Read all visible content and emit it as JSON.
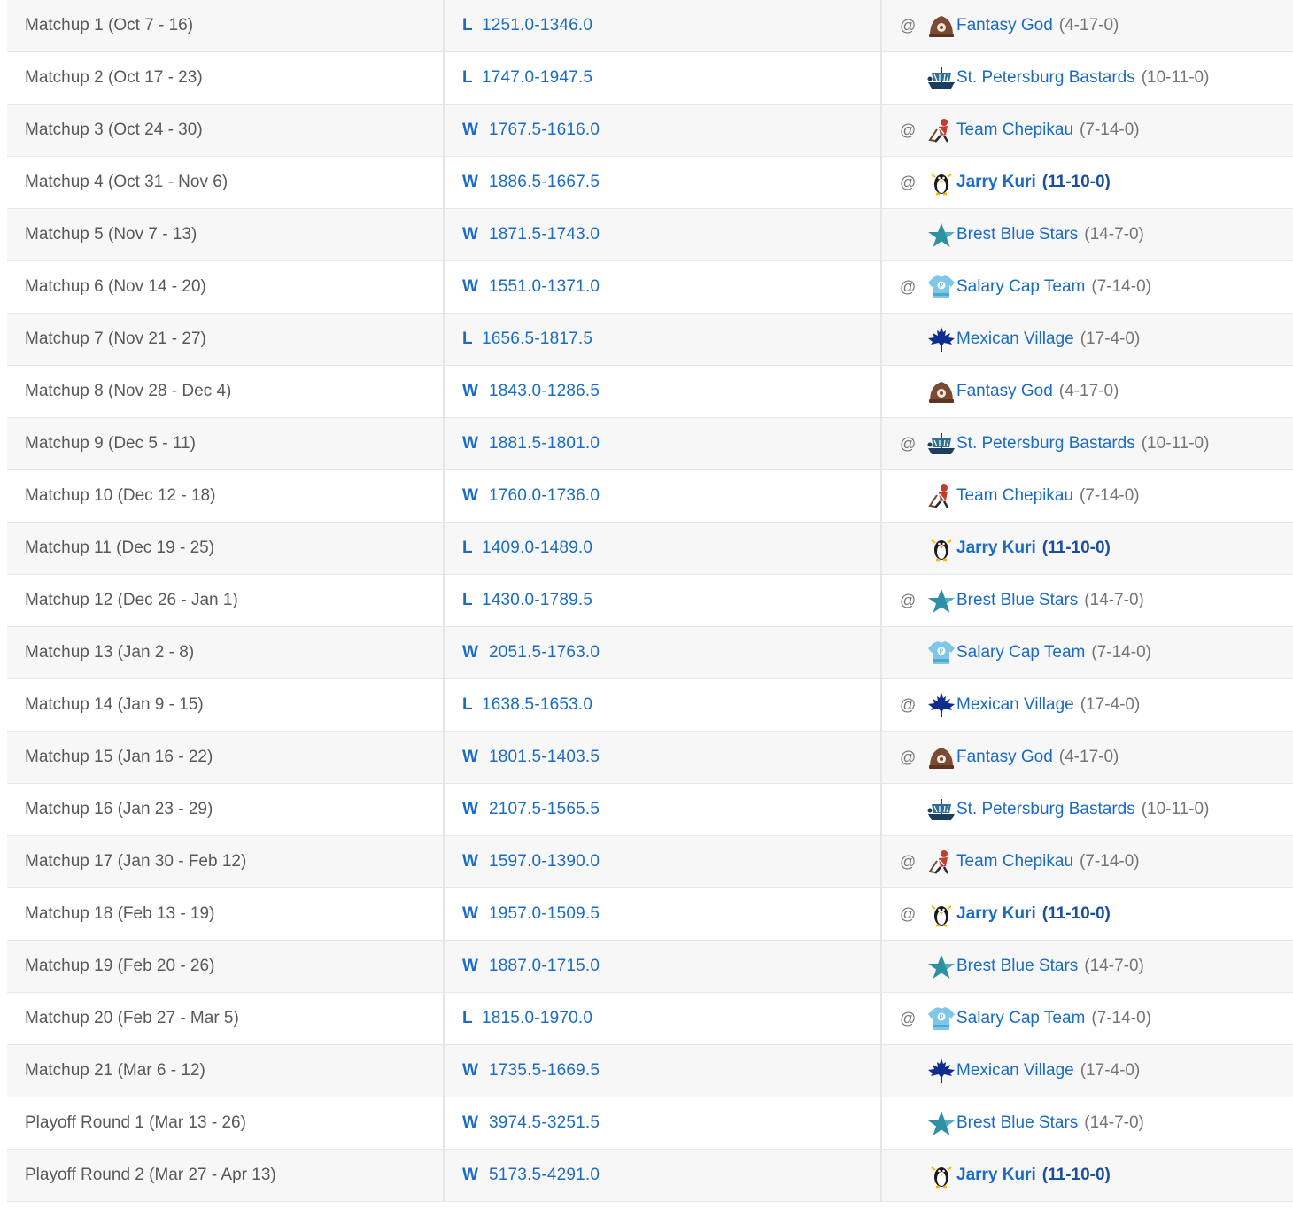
{
  "colors": {
    "link": "#1a6bc6",
    "week_text": "#595959",
    "record_text": "#757575",
    "row_alt": "#f7f7f7"
  },
  "rows": [
    {
      "week": "Matchup 1 (Oct 7 - 16)",
      "result": "L",
      "score": "1251.0-1346.0",
      "at": "@",
      "team": "Fantasy God",
      "record": "(4-17-0)",
      "logo": "hat-icon",
      "bold": false
    },
    {
      "week": "Matchup 2 (Oct 17 - 23)",
      "result": "L",
      "score": "1747.0-1947.5",
      "at": "",
      "team": "St. Petersburg Bastards",
      "record": "(10-11-0)",
      "logo": "viking-ship-icon",
      "bold": false
    },
    {
      "week": "Matchup 3 (Oct 24 - 30)",
      "result": "W",
      "score": "1767.5-1616.0",
      "at": "@",
      "team": "Team Chepikau",
      "record": "(7-14-0)",
      "logo": "hockey-player-icon",
      "bold": false
    },
    {
      "week": "Matchup 4 (Oct 31 - Nov 6)",
      "result": "W",
      "score": "1886.5-1667.5",
      "at": "@",
      "team": "Jarry Kuri",
      "record": "(11-10-0)",
      "logo": "penguin-icon",
      "bold": true
    },
    {
      "week": "Matchup 5 (Nov 7 - 13)",
      "result": "W",
      "score": "1871.5-1743.0",
      "at": "",
      "team": "Brest Blue Stars",
      "record": "(14-7-0)",
      "logo": "star-icon",
      "bold": false
    },
    {
      "week": "Matchup 6 (Nov 14 - 20)",
      "result": "W",
      "score": "1551.0-1371.0",
      "at": "@",
      "team": "Salary Cap Team",
      "record": "(7-14-0)",
      "logo": "jersey-icon",
      "bold": false
    },
    {
      "week": "Matchup 7 (Nov 21 - 27)",
      "result": "L",
      "score": "1656.5-1817.5",
      "at": "",
      "team": "Mexican Village",
      "record": "(17-4-0)",
      "logo": "maple-leaf-icon",
      "bold": false
    },
    {
      "week": "Matchup 8 (Nov 28 - Dec 4)",
      "result": "W",
      "score": "1843.0-1286.5",
      "at": "",
      "team": "Fantasy God",
      "record": "(4-17-0)",
      "logo": "hat-icon",
      "bold": false
    },
    {
      "week": "Matchup 9 (Dec 5 - 11)",
      "result": "W",
      "score": "1881.5-1801.0",
      "at": "@",
      "team": "St. Petersburg Bastards",
      "record": "(10-11-0)",
      "logo": "viking-ship-icon",
      "bold": false
    },
    {
      "week": "Matchup 10 (Dec 12 - 18)",
      "result": "W",
      "score": "1760.0-1736.0",
      "at": "",
      "team": "Team Chepikau",
      "record": "(7-14-0)",
      "logo": "hockey-player-icon",
      "bold": false
    },
    {
      "week": "Matchup 11 (Dec 19 - 25)",
      "result": "L",
      "score": "1409.0-1489.0",
      "at": "",
      "team": "Jarry Kuri",
      "record": "(11-10-0)",
      "logo": "penguin-icon",
      "bold": true
    },
    {
      "week": "Matchup 12 (Dec 26 - Jan 1)",
      "result": "L",
      "score": "1430.0-1789.5",
      "at": "@",
      "team": "Brest Blue Stars",
      "record": "(14-7-0)",
      "logo": "star-icon",
      "bold": false
    },
    {
      "week": "Matchup 13 (Jan 2 - 8)",
      "result": "W",
      "score": "2051.5-1763.0",
      "at": "",
      "team": "Salary Cap Team",
      "record": "(7-14-0)",
      "logo": "jersey-icon",
      "bold": false
    },
    {
      "week": "Matchup 14 (Jan 9 - 15)",
      "result": "L",
      "score": "1638.5-1653.0",
      "at": "@",
      "team": "Mexican Village",
      "record": "(17-4-0)",
      "logo": "maple-leaf-icon",
      "bold": false
    },
    {
      "week": "Matchup 15 (Jan 16 - 22)",
      "result": "W",
      "score": "1801.5-1403.5",
      "at": "@",
      "team": "Fantasy God",
      "record": "(4-17-0)",
      "logo": "hat-icon",
      "bold": false
    },
    {
      "week": "Matchup 16 (Jan 23 - 29)",
      "result": "W",
      "score": "2107.5-1565.5",
      "at": "",
      "team": "St. Petersburg Bastards",
      "record": "(10-11-0)",
      "logo": "viking-ship-icon",
      "bold": false
    },
    {
      "week": "Matchup 17 (Jan 30 - Feb 12)",
      "result": "W",
      "score": "1597.0-1390.0",
      "at": "@",
      "team": "Team Chepikau",
      "record": "(7-14-0)",
      "logo": "hockey-player-icon",
      "bold": false
    },
    {
      "week": "Matchup 18 (Feb 13 - 19)",
      "result": "W",
      "score": "1957.0-1509.5",
      "at": "@",
      "team": "Jarry Kuri",
      "record": "(11-10-0)",
      "logo": "penguin-icon",
      "bold": true
    },
    {
      "week": "Matchup 19 (Feb 20 - 26)",
      "result": "W",
      "score": "1887.0-1715.0",
      "at": "",
      "team": "Brest Blue Stars",
      "record": "(14-7-0)",
      "logo": "star-icon",
      "bold": false
    },
    {
      "week": "Matchup 20 (Feb 27 - Mar 5)",
      "result": "L",
      "score": "1815.0-1970.0",
      "at": "@",
      "team": "Salary Cap Team",
      "record": "(7-14-0)",
      "logo": "jersey-icon",
      "bold": false
    },
    {
      "week": "Matchup 21 (Mar 6 - 12)",
      "result": "W",
      "score": "1735.5-1669.5",
      "at": "",
      "team": "Mexican Village",
      "record": "(17-4-0)",
      "logo": "maple-leaf-icon",
      "bold": false
    },
    {
      "week": "Playoff Round 1 (Mar 13 - 26)",
      "result": "W",
      "score": "3974.5-3251.5",
      "at": "",
      "team": "Brest Blue Stars",
      "record": "(14-7-0)",
      "logo": "star-icon",
      "bold": false
    },
    {
      "week": "Playoff Round 2 (Mar 27 - Apr 13)",
      "result": "W",
      "score": "5173.5-4291.0",
      "at": "",
      "team": "Jarry Kuri",
      "record": "(11-10-0)",
      "logo": "penguin-icon",
      "bold": true
    }
  ]
}
